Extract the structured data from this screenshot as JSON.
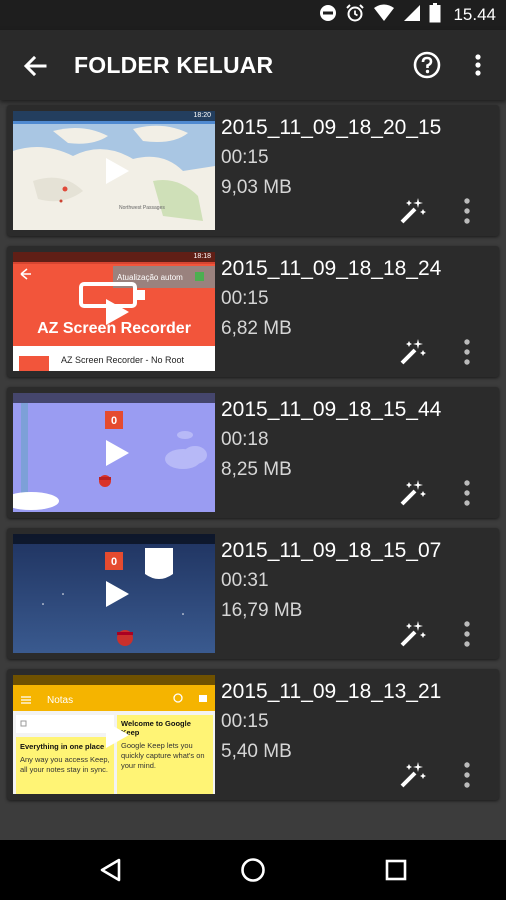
{
  "status_bar": {
    "time": "15.44",
    "icons": [
      "do-not-disturb-icon",
      "alarm-icon",
      "wifi-icon",
      "signal-icon",
      "battery-icon"
    ]
  },
  "app_bar": {
    "title": "FOLDER KELUAR",
    "back_icon": "arrow-back-icon",
    "help_icon": "help-circle-icon",
    "menu_icon": "more-vert-icon"
  },
  "recordings": [
    {
      "filename": "2015_11_09_18_20_15",
      "duration": "00:15",
      "size": "9,03 MB",
      "thumbnail": {
        "time": "18:20",
        "label": "Northwest Passages"
      }
    },
    {
      "filename": "2015_11_09_18_18_24",
      "duration": "00:15",
      "size": "6,82 MB",
      "thumbnail": {
        "time": "18:18",
        "label": "AZ Screen Recorder",
        "sub_label": "AZ Screen Recorder - No Root",
        "toast": "Atualização autom"
      }
    },
    {
      "filename": "2015_11_09_18_15_44",
      "duration": "00:18",
      "size": "8,25 MB",
      "thumbnail": {
        "score": "0"
      }
    },
    {
      "filename": "2015_11_09_18_15_07",
      "duration": "00:31",
      "size": "16,79 MB",
      "thumbnail": {
        "score": "0"
      }
    },
    {
      "filename": "2015_11_09_18_13_21",
      "duration": "00:15",
      "size": "5,40 MB",
      "thumbnail": {
        "app_title": "Notas",
        "note_left_title": "Everything in one place",
        "note_left_body": "Any way you access Keep, all your notes stay in sync.",
        "note_right_title": "Welcome to Google Keep",
        "note_right_body": "Google Keep lets you quickly capture what's on your mind."
      }
    }
  ],
  "colors": {
    "background": "#3c3c3c",
    "card": "#2b2b2b",
    "app_bar": "#2a2a2a",
    "az_red": "#f2553b",
    "keep_yellow": "#f5b400",
    "flappy_purple": "#9a9cf2",
    "space_blue": "#243a6b"
  },
  "nav_bar": {
    "icons": [
      "nav-back-icon",
      "nav-home-icon",
      "nav-recents-icon"
    ]
  }
}
